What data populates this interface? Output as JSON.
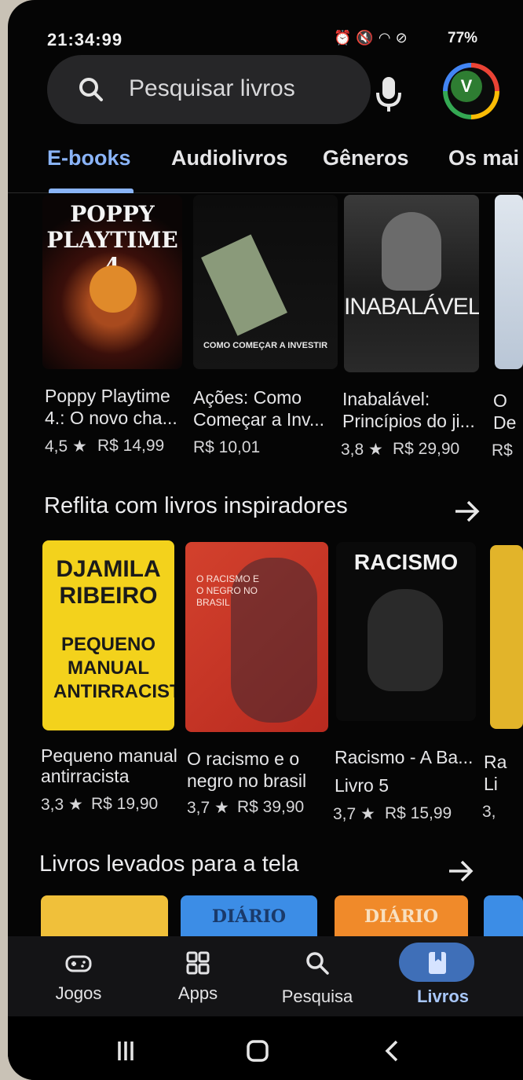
{
  "status_bar": {
    "time": "21:34:99",
    "battery": "77%",
    "icons": [
      "alarm-icon",
      "mute-icon",
      "wifi-icon",
      "blocked-icon",
      "volte-icon",
      "signal-icon"
    ]
  },
  "search": {
    "placeholder": "Pesquisar livros"
  },
  "avatar": {
    "initial": "V"
  },
  "tabs": [
    {
      "label": "E-books",
      "active": true
    },
    {
      "label": "Audiolivros"
    },
    {
      "label": "Gêneros"
    },
    {
      "label": "Os mai"
    }
  ],
  "row1": [
    {
      "title1": "Poppy Playtime",
      "title2": "4.: O novo cha...",
      "rating": "4,5 ★",
      "price": "R$ 14,99",
      "cover_text": "POPPY PLAYTIME 4"
    },
    {
      "title1": "Ações: Como",
      "title2": "Começar a Inv...",
      "rating": "",
      "price": "R$ 10,01",
      "cover_text": "COMO COMEÇAR A INVESTIR"
    },
    {
      "title1": "Inabalável:",
      "title2": "Princípios do ji...",
      "rating": "3,8 ★",
      "price": "R$ 29,90",
      "cover_text": "INABALÁVEL"
    },
    {
      "title1": "O",
      "title2": "De",
      "rating": "",
      "price": "R$"
    }
  ],
  "section2": {
    "title": "Reflita com livros inspiradores",
    "books": [
      {
        "title1": "Pequeno manual",
        "title2": "antirracista",
        "rating": "3,3 ★",
        "price": "R$ 19,90",
        "cover_text1": "DJAMILA RIBEIRO",
        "cover_text2": "PEQUENO MANUAL ANTIRRACISTA"
      },
      {
        "title1": "O racismo e o",
        "title2": "negro no brasil",
        "rating": "3,7 ★",
        "price": "R$ 39,90",
        "cover_text": "O RACISMO E O NEGRO NO BRASIL"
      },
      {
        "title1": "Racismo - A Ba...",
        "title2": "Livro 5",
        "rating": "3,7 ★",
        "price": "R$ 15,99",
        "cover_text": "RACISMO"
      },
      {
        "title1": "Ra",
        "title2": "Li",
        "rating": "3,",
        "price": ""
      }
    ]
  },
  "section3": {
    "title": "Livros levados para a tela",
    "cover_text": "DIÁRIO"
  },
  "bottom_nav": [
    {
      "label": "Jogos",
      "icon": "gamepad-icon"
    },
    {
      "label": "Apps",
      "icon": "apps-grid-icon"
    },
    {
      "label": "Pesquisa",
      "icon": "search-icon"
    },
    {
      "label": "Livros",
      "icon": "book-icon",
      "active": true
    }
  ],
  "system_nav": [
    "recents-icon",
    "home-icon",
    "back-icon"
  ],
  "colors": {
    "accent": "#8ab4f8",
    "background": "#050505",
    "nav_pill": "#3f6fb8"
  }
}
